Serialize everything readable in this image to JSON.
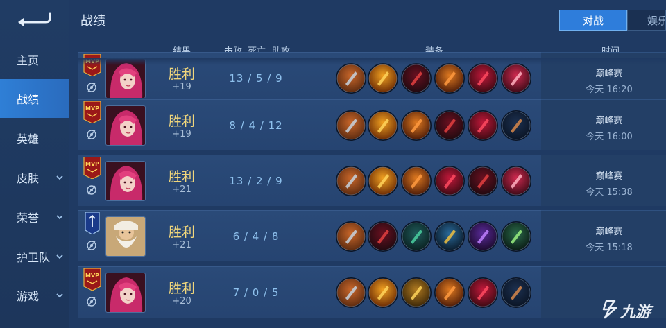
{
  "sidebar": {
    "items": [
      {
        "label": "主页",
        "expandable": false
      },
      {
        "label": "战绩",
        "expandable": false
      },
      {
        "label": "英雄",
        "expandable": false
      },
      {
        "label": "皮肤",
        "expandable": true
      },
      {
        "label": "荣誉",
        "expandable": true
      },
      {
        "label": "护卫队",
        "expandable": true
      },
      {
        "label": "游戏",
        "expandable": true
      }
    ],
    "active_index": 1
  },
  "header": {
    "title": "战绩",
    "tabs": [
      {
        "label": "对战",
        "active": true
      },
      {
        "label": "娱乐",
        "active": false
      }
    ]
  },
  "columns": {
    "result": "结果",
    "kills": "击败",
    "deaths": "死亡",
    "assists": "助攻",
    "equipment": "装备",
    "time": "时间"
  },
  "matches": [
    {
      "badge": "mvp",
      "hero": "pink-haired-heroine",
      "result": "胜利",
      "points": "+19",
      "kda": "13 / 5 / 9",
      "mode": "巅峰赛",
      "time": "今天 16:20",
      "items": [
        "boots-icon",
        "flame-dagger-icon",
        "dark-blade-icon",
        "flame-sword-icon",
        "crimson-armor-icon",
        "crimson-crossbow-icon"
      ]
    },
    {
      "badge": "mvp",
      "hero": "pink-haired-heroine",
      "result": "胜利",
      "points": "+19",
      "kda": "8 / 4 / 12",
      "mode": "巅峰赛",
      "time": "今天 16:00",
      "items": [
        "boots-icon",
        "flame-dagger-icon",
        "flame-sword-icon",
        "dark-blade-icon",
        "crimson-armor-icon",
        "gauntlet-icon"
      ]
    },
    {
      "badge": "mvp",
      "hero": "pink-haired-heroine",
      "result": "胜利",
      "points": "+21",
      "kda": "13 / 2 / 9",
      "mode": "巅峰赛",
      "time": "今天 15:38",
      "items": [
        "boots-icon",
        "flame-dagger-icon",
        "flame-sword-icon",
        "crimson-armor-icon",
        "dark-blade-icon",
        "crimson-crossbow-icon"
      ]
    },
    {
      "badge": "tank",
      "hero": "white-bearded-warrior",
      "result": "胜利",
      "points": "+21",
      "kda": "6 / 4 / 8",
      "mode": "巅峰赛",
      "time": "今天 15:18",
      "items": [
        "boots-icon",
        "dark-blade-icon",
        "green-boots-icon",
        "gold-shield-icon",
        "purple-axe-icon",
        "green-blade-icon"
      ]
    },
    {
      "badge": "mvp",
      "hero": "pink-haired-heroine",
      "result": "胜利",
      "points": "+20",
      "kda": "7 / 0 / 5",
      "mode": "",
      "time": "",
      "items": [
        "boots-icon",
        "flame-dagger-icon",
        "golden-bow-icon",
        "flame-sword-icon",
        "crimson-armor-icon",
        "gauntlet-icon"
      ]
    }
  ],
  "watermark": {
    "text": "九游"
  },
  "colors": {
    "accent": "#2e7ddb",
    "win": "#f0d67c",
    "kda": "#8fc2ee",
    "background": "#1f3a63"
  }
}
